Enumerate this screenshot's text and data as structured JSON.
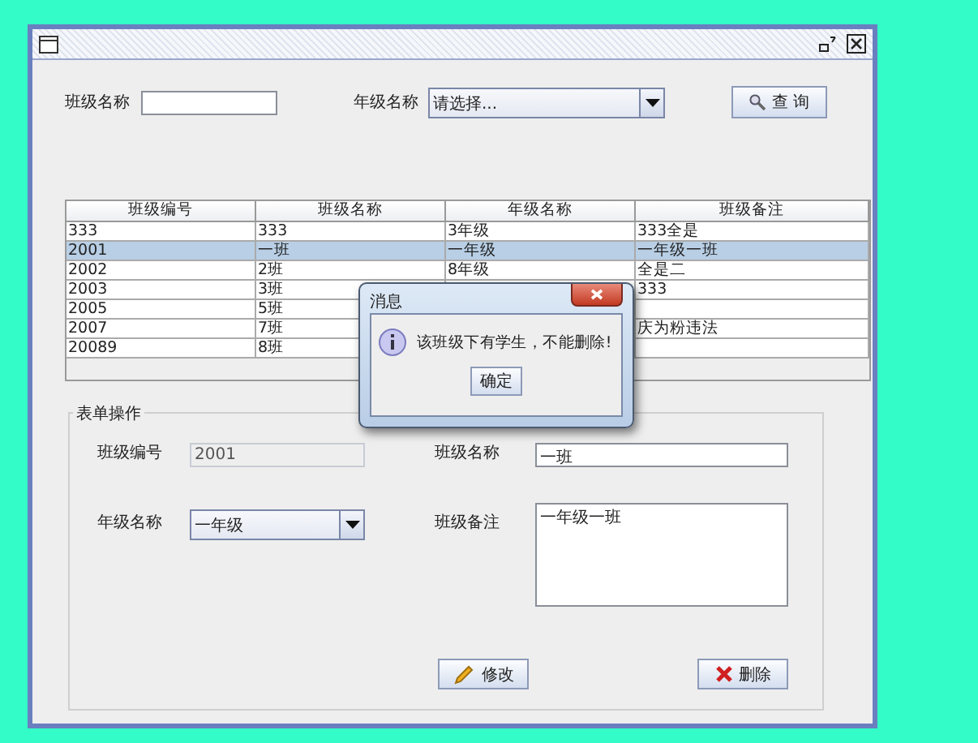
{
  "search": {
    "class_label": "班级名称",
    "grade_label": "年级名称",
    "grade_value": "请选择...",
    "button": "查 询"
  },
  "table": {
    "columns": [
      "班级编号",
      "班级名称",
      "年级名称",
      "班级备注"
    ],
    "rows": [
      {
        "cells": [
          "333",
          "333",
          "3年级",
          "333全是"
        ],
        "selected": false
      },
      {
        "cells": [
          "2001",
          "一班",
          "一年级",
          "一年级一班"
        ],
        "selected": true
      },
      {
        "cells": [
          "2002",
          "2班",
          "8年级",
          "全是二"
        ],
        "selected": false
      },
      {
        "cells": [
          "2003",
          "3班",
          null,
          "333"
        ],
        "selected": false
      },
      {
        "cells": [
          "2005",
          "5班",
          null,
          null
        ],
        "selected": false
      },
      {
        "cells": [
          "2007",
          "7班",
          null,
          "庆为粉违法"
        ],
        "selected": false
      },
      {
        "cells": [
          "20089",
          "8班",
          null,
          null
        ],
        "selected": false
      }
    ]
  },
  "form": {
    "title": "表单操作",
    "id_label": "班级编号",
    "id_value": "2001",
    "name_label": "班级名称",
    "name_value": "一班",
    "grade_label": "年级名称",
    "grade_value": "一年级",
    "note_label": "班级备注",
    "note_value": "一年级一班",
    "edit_button": "修改",
    "delete_button": "删除"
  },
  "dialog": {
    "title": "消息",
    "message": "该班级下有学生，不能删除!",
    "ok_button": "确定"
  }
}
